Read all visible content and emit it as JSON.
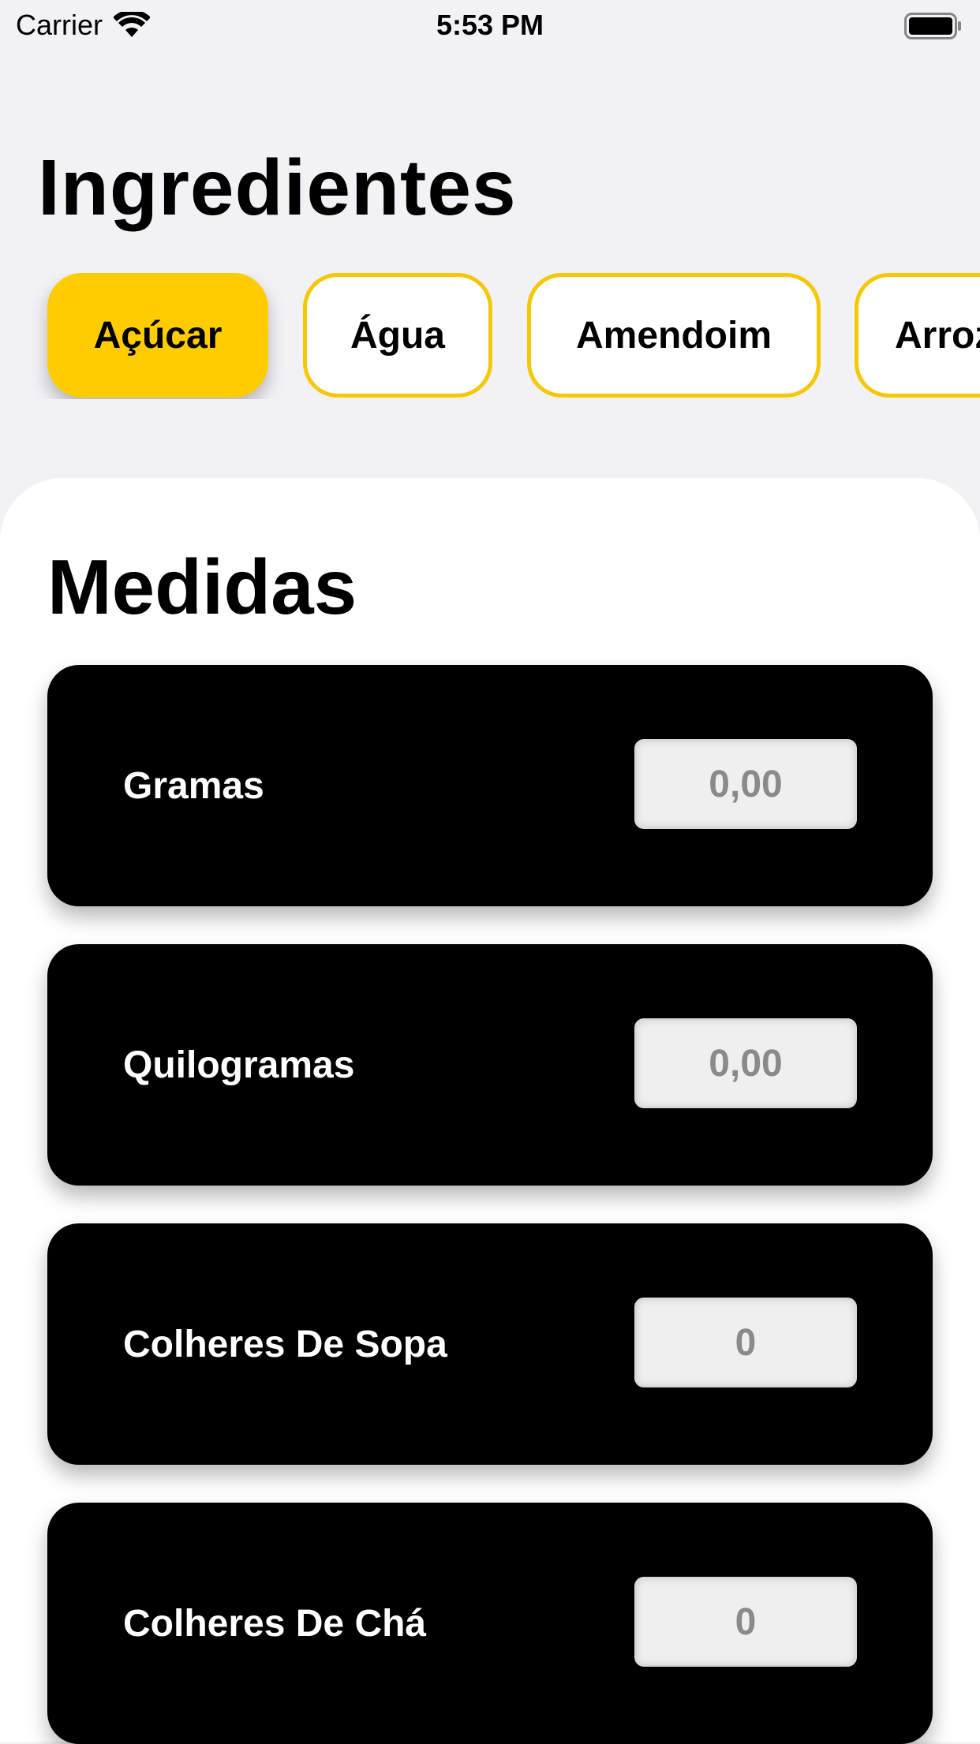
{
  "status_bar": {
    "carrier": "Carrier",
    "time": "5:53 PM",
    "icons": [
      "wifi-icon",
      "battery-icon"
    ]
  },
  "title": "Ingredientes",
  "ingredients": [
    {
      "label": "Açúcar",
      "selected": true
    },
    {
      "label": "Água",
      "selected": false
    },
    {
      "label": "Amendoim",
      "selected": false
    },
    {
      "label": "Arroz",
      "selected": false
    }
  ],
  "section_title": "Medidas",
  "measures": [
    {
      "label": "Gramas",
      "placeholder": "0,00"
    },
    {
      "label": "Quilogramas",
      "placeholder": "0,00"
    },
    {
      "label": "Colheres De Sopa",
      "placeholder": "0"
    },
    {
      "label": "Colheres De Chá",
      "placeholder": "0"
    }
  ],
  "colors": {
    "accent": "#ffcc00",
    "background": "#f2f1f6",
    "card": "#000000"
  }
}
